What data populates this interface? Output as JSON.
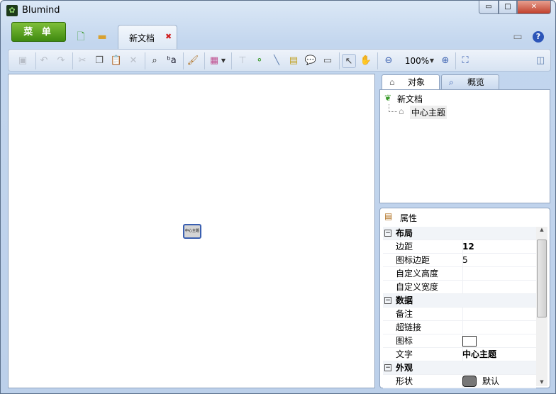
{
  "window": {
    "title": "Blumind",
    "minimize": "▭",
    "maximize": "□",
    "close": "✕"
  },
  "menu": {
    "label": "菜 单"
  },
  "doc_tab": {
    "label": "新文档",
    "close": "✖"
  },
  "toolbar": {
    "zoom": "100%"
  },
  "canvas": {
    "node_text": "中心主题"
  },
  "side_tabs": {
    "objects": "对象",
    "overview": "概览"
  },
  "tree": {
    "root": "新文档",
    "child": "中心主题"
  },
  "properties": {
    "title": "属性",
    "rows": [
      {
        "type": "cat",
        "name": "布局"
      },
      {
        "name": "边距",
        "value": "12",
        "bold": true
      },
      {
        "name": "图标边距",
        "value": "5"
      },
      {
        "name": "自定义高度",
        "value": ""
      },
      {
        "name": "自定义宽度",
        "value": ""
      },
      {
        "type": "cat",
        "name": "数据"
      },
      {
        "name": "备注",
        "value": ""
      },
      {
        "name": "超链接",
        "value": ""
      },
      {
        "name": "图标",
        "value": ""
      },
      {
        "name": "文字",
        "value": "中心主题",
        "bold": true
      },
      {
        "type": "cat",
        "name": "外观"
      },
      {
        "name": "形状",
        "value": "默认"
      }
    ],
    "collapse_glyph": "−"
  }
}
